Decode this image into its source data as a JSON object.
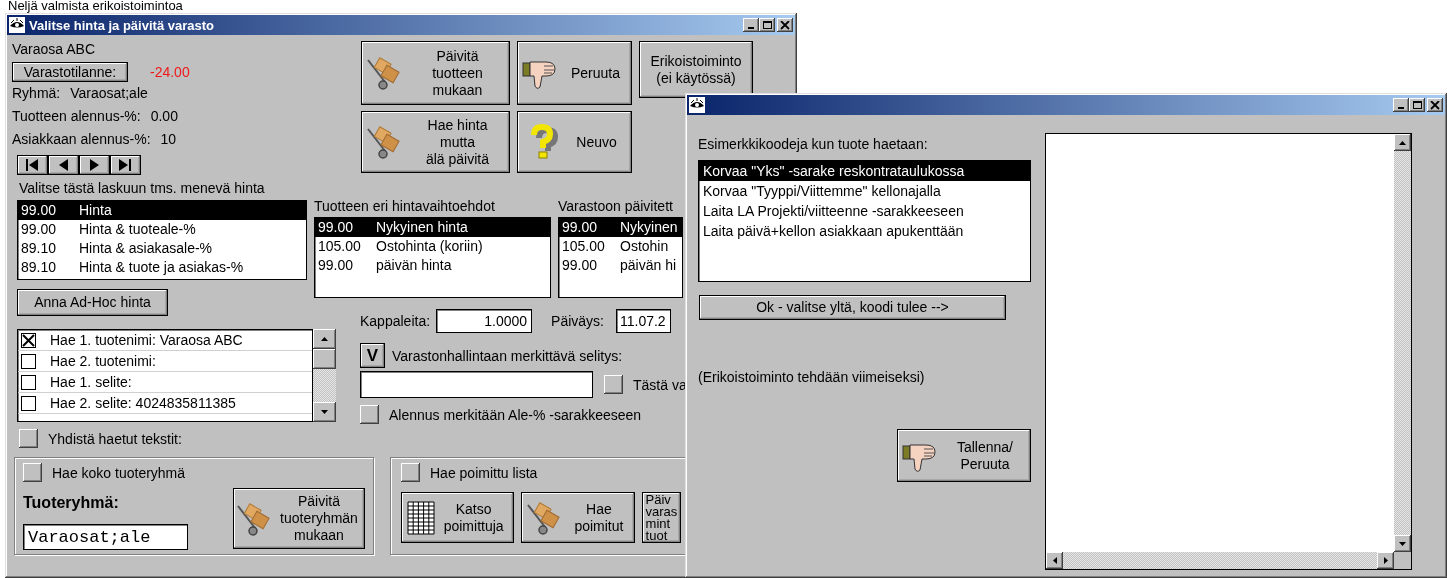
{
  "background_text": "Neljä valmista erikoistoimintoa",
  "main_window": {
    "title": "Valitse hinta ja päivitä varasto",
    "product_name": "Varaosa ABC",
    "stock_button": "Varastotilanne:",
    "stock_value": "-24.00",
    "info_lines": [
      {
        "label": "Ryhmä:",
        "value": "Varaosat;ale"
      },
      {
        "label": "Tuotteen alennus-%:",
        "value": "0.00"
      },
      {
        "label": "Asiakkaan alennus-%:",
        "value": "10"
      }
    ],
    "action_buttons": [
      {
        "kind": "truck",
        "label": "Päivitä\ntuotteen\nmukaan"
      },
      {
        "kind": "thumb",
        "label": "Peruuta"
      },
      {
        "kind": "text",
        "label": "Erikoistoiminto\n(ei käytössä)"
      },
      {
        "kind": "truck",
        "label": "Hae hinta\nmutta\nälä päivitä"
      },
      {
        "kind": "question",
        "label": "Neuvo"
      }
    ],
    "price_list": {
      "label": "Valitse tästä laskuun tms. menevä hinta",
      "items": [
        {
          "price": "99.00",
          "name": "Hinta",
          "selected": true
        },
        {
          "price": "99.00",
          "name": "Hinta & tuoteale-%",
          "selected": false
        },
        {
          "price": "89.10",
          "name": "Hinta & asiakasale-%",
          "selected": false
        },
        {
          "price": "89.10",
          "name": "Hinta & tuote ja asiakas-%",
          "selected": false
        }
      ]
    },
    "adhoc_button": "Anna Ad-Hoc hinta",
    "price_options": {
      "label": "Tuotteen eri hintavaihtoehdot",
      "items": [
        {
          "price": "99.00",
          "name": "Nykyinen hinta",
          "selected": true
        },
        {
          "price": "105.00",
          "name": "Ostohinta (koriin)",
          "selected": false
        },
        {
          "price": "99.00",
          "name": "päivän hinta",
          "selected": false
        }
      ]
    },
    "stock_options": {
      "label": "Varastoon päivitett",
      "items": [
        {
          "price": "99.00",
          "name": "Nykyinen",
          "selected": true
        },
        {
          "price": "105.00",
          "name": "Ostohin",
          "selected": false
        },
        {
          "price": "99.00",
          "name": "päivän hi",
          "selected": false
        }
      ]
    },
    "quantity": {
      "label": "Kappaleita:",
      "value": "1.0000"
    },
    "date": {
      "label": "Päiväys:",
      "value": "11.07.2"
    },
    "v_button": "V",
    "note_label": "Varastonhallintaan merkittävä selitys:",
    "from_checkbox": {
      "label": "Tästä va",
      "checked": false
    },
    "discount_checkbox": {
      "label": "Alennus merkitään Ale-% -sarakkeeseen",
      "checked": false
    },
    "fetch_texts": [
      {
        "label": "Hae 1. tuotenimi: Varaosa ABC",
        "checked": true
      },
      {
        "label": "Hae 2. tuotenimi:",
        "checked": false
      },
      {
        "label": "Hae 1. selite:",
        "checked": false
      },
      {
        "label": "Hae 2. selite: 4024835811385",
        "checked": false
      }
    ],
    "combine_checkbox": {
      "label": "Yhdistä haetut tekstit:",
      "checked": false
    },
    "group_section": {
      "checkbox": {
        "label": "Hae koko tuoteryhmä",
        "checked": false
      },
      "heading": "Tuoteryhmä:",
      "value": "Varaosat;ale",
      "button": "Päivitä\ntuoteryhmän\nmukaan"
    },
    "picked_section": {
      "checkbox": {
        "label": "Hae poimittu lista",
        "checked": false
      },
      "buttons": [
        {
          "kind": "grid",
          "label": "Katso\npoimittuja"
        },
        {
          "kind": "truck",
          "label": "Hae\npoimitut"
        },
        {
          "kind": "text",
          "label": "Päiv\nvaras\nmint\ntuot"
        }
      ]
    }
  },
  "dialog": {
    "label": "Esimerkkikoodeja kun tuote haetaan:",
    "items": [
      {
        "text": "Korvaa \"Yks\" -sarake reskontrataulukossa",
        "selected": true
      },
      {
        "text": "Korvaa \"Tyyppi/Viittemme\" kellonajalla",
        "selected": false
      },
      {
        "text": "Laita LA Projekti/viitteenne -sarakkeeseen",
        "selected": false
      },
      {
        "text": "Laita päivä+kellon asiakkaan apukenttään",
        "selected": false
      }
    ],
    "ok_button": "Ok - valitse yltä, koodi tulee -->",
    "note": "(Erikoistoiminto tehdään viimeiseksi)",
    "save_button": "Tallenna/\nPeruuta"
  }
}
